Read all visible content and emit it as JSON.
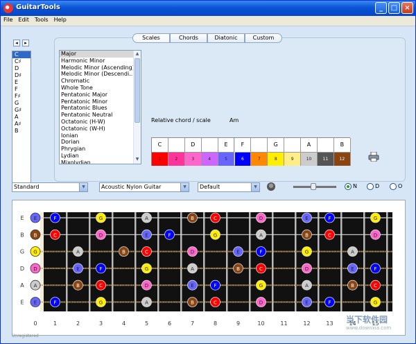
{
  "window": {
    "title": "GuitarTools",
    "min": "_",
    "max": "□",
    "close": "×"
  },
  "menu": [
    "File",
    "Edit",
    "Tools",
    "Help"
  ],
  "nav": {
    "back": "◂",
    "fwd": "▸"
  },
  "notes": [
    "C",
    "C♯",
    "D",
    "D♯",
    "E",
    "F",
    "F♯",
    "G",
    "G♯",
    "A",
    "A♯",
    "B"
  ],
  "selected_note": "C",
  "tabs": [
    "Scales",
    "Chords",
    "Diatonic",
    "Custom"
  ],
  "active_tab": "Scales",
  "scales": [
    "Major",
    "Harmonic Minor",
    "Melodic Minor (Ascending)",
    "Melodic Minor (Descendi...",
    "Chromatic",
    "Whole Tone",
    "Pentatonic Major",
    "Pentatonic Minor",
    "Pentatonic Blues",
    "Pentatonic Neutral",
    "Octatonic (H-W)",
    "Octatonic (W-H)",
    "Ionian",
    "Dorian",
    "Phrygian",
    "Lydian",
    "Mixolydian"
  ],
  "selected_scale": "Major",
  "relative": {
    "label": "Relative chord / scale",
    "value": "Am"
  },
  "chromatic": {
    "top": [
      "C",
      "",
      "D",
      "",
      "E",
      "F",
      "",
      "G",
      "",
      "A",
      "",
      "B"
    ],
    "bottom": [
      "1",
      "2",
      "3",
      "4",
      "5",
      "6",
      "7",
      "8",
      "9",
      "10",
      "11",
      "12"
    ],
    "colors": [
      "#ff0000",
      "#ff3399",
      "#ff66cc",
      "#cc66ff",
      "#6666ff",
      "#0000ff",
      "#ff8800",
      "#ffee00",
      "#ffee88",
      "#cccccc",
      "#555555",
      "#8b4513"
    ]
  },
  "tuning": "Standard",
  "instrument": "Acoustic Nylon Guitar",
  "sound": "Default",
  "radios": [
    {
      "label": "N",
      "on": true
    },
    {
      "label": "D",
      "on": false
    },
    {
      "label": "O",
      "on": false
    }
  ],
  "string_labels": [
    "E",
    "B",
    "G",
    "D",
    "A",
    "E"
  ],
  "fret_numbers": [
    "0",
    "1",
    "2",
    "3",
    "4",
    "5",
    "6",
    "7",
    "8",
    "9",
    "10",
    "11",
    "12",
    "13",
    "14",
    "15"
  ],
  "dots": [
    {
      "s": 0,
      "f": 0,
      "n": "E",
      "c": 4
    },
    {
      "s": 0,
      "f": 1,
      "n": "F",
      "c": 5
    },
    {
      "s": 0,
      "f": 3,
      "n": "G",
      "c": 7
    },
    {
      "s": 0,
      "f": 5,
      "n": "A",
      "c": 9
    },
    {
      "s": 0,
      "f": 7,
      "n": "B",
      "c": 11
    },
    {
      "s": 0,
      "f": 8,
      "n": "C",
      "c": 0
    },
    {
      "s": 0,
      "f": 10,
      "n": "D",
      "c": 2
    },
    {
      "s": 0,
      "f": 12,
      "n": "E",
      "c": 4
    },
    {
      "s": 0,
      "f": 13,
      "n": "F",
      "c": 5
    },
    {
      "s": 0,
      "f": 15,
      "n": "G",
      "c": 7
    },
    {
      "s": 1,
      "f": 0,
      "n": "B",
      "c": 11
    },
    {
      "s": 1,
      "f": 1,
      "n": "C",
      "c": 0
    },
    {
      "s": 1,
      "f": 3,
      "n": "D",
      "c": 2
    },
    {
      "s": 1,
      "f": 5,
      "n": "E",
      "c": 4
    },
    {
      "s": 1,
      "f": 6,
      "n": "F",
      "c": 5
    },
    {
      "s": 1,
      "f": 8,
      "n": "G",
      "c": 7
    },
    {
      "s": 1,
      "f": 10,
      "n": "A",
      "c": 9
    },
    {
      "s": 1,
      "f": 12,
      "n": "B",
      "c": 11
    },
    {
      "s": 1,
      "f": 13,
      "n": "C",
      "c": 0
    },
    {
      "s": 1,
      "f": 15,
      "n": "D",
      "c": 2
    },
    {
      "s": 2,
      "f": 0,
      "n": "G",
      "c": 7
    },
    {
      "s": 2,
      "f": 2,
      "n": "A",
      "c": 9
    },
    {
      "s": 2,
      "f": 4,
      "n": "B",
      "c": 11
    },
    {
      "s": 2,
      "f": 5,
      "n": "C",
      "c": 0
    },
    {
      "s": 2,
      "f": 7,
      "n": "D",
      "c": 2
    },
    {
      "s": 2,
      "f": 9,
      "n": "E",
      "c": 4
    },
    {
      "s": 2,
      "f": 10,
      "n": "F",
      "c": 5
    },
    {
      "s": 2,
      "f": 12,
      "n": "G",
      "c": 7
    },
    {
      "s": 2,
      "f": 14,
      "n": "A",
      "c": 9
    },
    {
      "s": 3,
      "f": 0,
      "n": "D",
      "c": 2
    },
    {
      "s": 3,
      "f": 2,
      "n": "E",
      "c": 4
    },
    {
      "s": 3,
      "f": 3,
      "n": "F",
      "c": 5
    },
    {
      "s": 3,
      "f": 5,
      "n": "G",
      "c": 7
    },
    {
      "s": 3,
      "f": 7,
      "n": "A",
      "c": 9
    },
    {
      "s": 3,
      "f": 9,
      "n": "B",
      "c": 11
    },
    {
      "s": 3,
      "f": 10,
      "n": "C",
      "c": 0
    },
    {
      "s": 3,
      "f": 12,
      "n": "D",
      "c": 2
    },
    {
      "s": 3,
      "f": 14,
      "n": "E",
      "c": 4
    },
    {
      "s": 3,
      "f": 15,
      "n": "F",
      "c": 5
    },
    {
      "s": 4,
      "f": 0,
      "n": "A",
      "c": 9
    },
    {
      "s": 4,
      "f": 2,
      "n": "B",
      "c": 11
    },
    {
      "s": 4,
      "f": 3,
      "n": "C",
      "c": 0
    },
    {
      "s": 4,
      "f": 5,
      "n": "D",
      "c": 2
    },
    {
      "s": 4,
      "f": 7,
      "n": "E",
      "c": 4
    },
    {
      "s": 4,
      "f": 8,
      "n": "F",
      "c": 5
    },
    {
      "s": 4,
      "f": 10,
      "n": "G",
      "c": 7
    },
    {
      "s": 4,
      "f": 12,
      "n": "A",
      "c": 9
    },
    {
      "s": 4,
      "f": 14,
      "n": "B",
      "c": 11
    },
    {
      "s": 4,
      "f": 15,
      "n": "C",
      "c": 0
    },
    {
      "s": 5,
      "f": 0,
      "n": "E",
      "c": 4
    },
    {
      "s": 5,
      "f": 1,
      "n": "F",
      "c": 5
    },
    {
      "s": 5,
      "f": 3,
      "n": "G",
      "c": 7
    },
    {
      "s": 5,
      "f": 5,
      "n": "A",
      "c": 9
    },
    {
      "s": 5,
      "f": 7,
      "n": "B",
      "c": 11
    },
    {
      "s": 5,
      "f": 8,
      "n": "C",
      "c": 0
    },
    {
      "s": 5,
      "f": 10,
      "n": "D",
      "c": 2
    },
    {
      "s": 5,
      "f": 12,
      "n": "E",
      "c": 4
    },
    {
      "s": 5,
      "f": 13,
      "n": "F",
      "c": 5
    },
    {
      "s": 5,
      "f": 15,
      "n": "G",
      "c": 7
    }
  ],
  "status": "Unregistered",
  "watermark": {
    "main": "当下软件园",
    "sub": "www.downxia.com"
  }
}
